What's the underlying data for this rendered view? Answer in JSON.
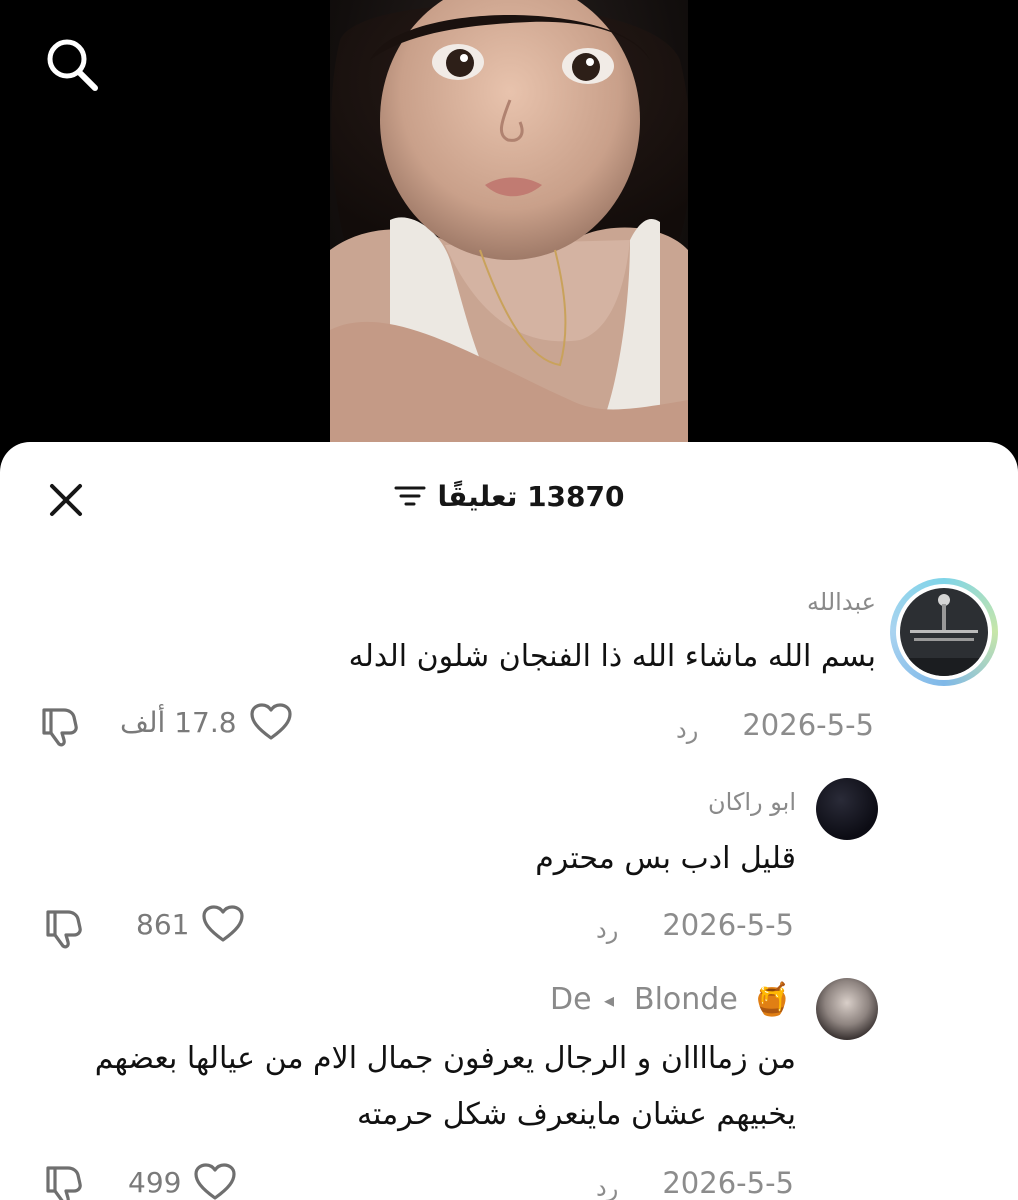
{
  "video": {
    "search_icon": "search-icon"
  },
  "sheet": {
    "comment_count": "13870 تعليقًا",
    "close_icon": "close-icon",
    "sort_icon": "sort-icon"
  },
  "comments": [
    {
      "username": "عبدالله",
      "text": "بسم الله ماشاء الله ذا الفنجان شلون الدله",
      "date": "2026-5-5",
      "reply": "رد",
      "likes": "17.8 ألف"
    },
    {
      "username": "ابو راكان",
      "text": "قليل ادب بس محترم",
      "date": "2026-5-5",
      "reply": "رد",
      "likes": "861"
    },
    {
      "username_left": "De",
      "username_right": "Blonde",
      "username_separator": "◂",
      "badge": "🍯",
      "text_line1": "من زماااان و الرجال يعرفون جمال الام من عيالها بعضهم",
      "text_line2": "يخبيهم عشان ماينعرف شكل حرمته",
      "date": "2026-5-5",
      "reply": "رد",
      "likes": "499"
    }
  ],
  "colors": {
    "sheet_bg": "#ffffff",
    "text_primary": "#111111",
    "text_secondary": "#8a8a8a",
    "video_bg": "#000000"
  }
}
